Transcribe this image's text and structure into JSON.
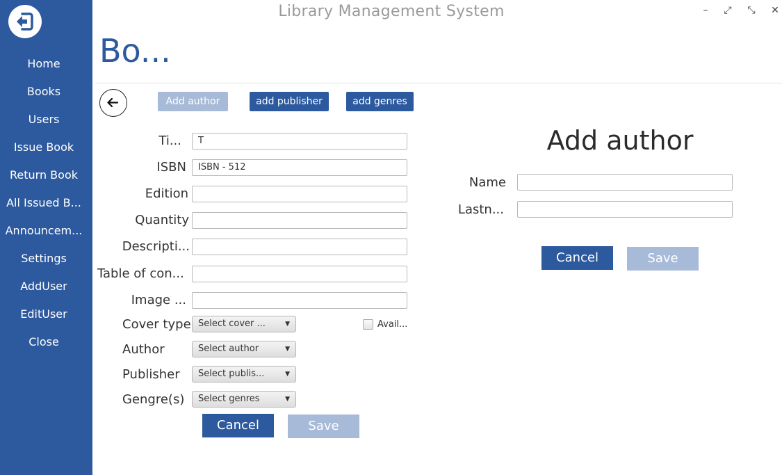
{
  "window": {
    "title": "Library Management System",
    "controls": {
      "minimize": "–",
      "restore": "⤢",
      "compact": "⤡",
      "close": "✕"
    }
  },
  "sidebar": {
    "logout_icon": "logout-icon",
    "items": [
      {
        "label": "Home"
      },
      {
        "label": "Books"
      },
      {
        "label": "Users"
      },
      {
        "label": "Issue Book"
      },
      {
        "label": "Return Book"
      },
      {
        "label": "All Issued B..."
      },
      {
        "label": "Announcem..."
      },
      {
        "label": "Settings"
      },
      {
        "label": "AddUser"
      },
      {
        "label": "EditUser"
      },
      {
        "label": "Close"
      }
    ]
  },
  "page": {
    "title": "Bo...",
    "back_icon": "arrow-left-icon"
  },
  "toolbar": {
    "add_author": "Add author",
    "add_publisher": "add publisher",
    "add_genres": "add genres"
  },
  "book_form": {
    "title_label": "Ti...",
    "title_value": "T",
    "isbn_label": "ISBN",
    "isbn_value": "ISBN - 512",
    "edition_label": "Edition",
    "edition_value": "",
    "quantity_label": "Quantity",
    "quantity_value": "",
    "description_label": "Descripti...",
    "description_value": "",
    "toc_label": "Table of con...",
    "toc_value": "",
    "image_label": "Image ...",
    "image_value": "",
    "cover_label": "Cover type",
    "cover_select": "Select cover ...",
    "available_label": "Avail...",
    "available_checked": false,
    "author_label": "Author",
    "author_select": "Select author",
    "publisher_label": "Publisher",
    "publisher_select": "Select publis...",
    "genres_label": "Gengre(s)",
    "genres_select": "Select genres",
    "cancel": "Cancel",
    "save": "Save"
  },
  "author_form": {
    "title": "Add author",
    "name_label": "Name",
    "name_value": "",
    "lastname_label": "Lastn...",
    "lastname_value": "",
    "cancel": "Cancel",
    "save": "Save"
  },
  "colors": {
    "primary": "#2d5a9e",
    "primary_disabled": "#a7bad8",
    "sidebar_bg": "#2d5a9e"
  }
}
